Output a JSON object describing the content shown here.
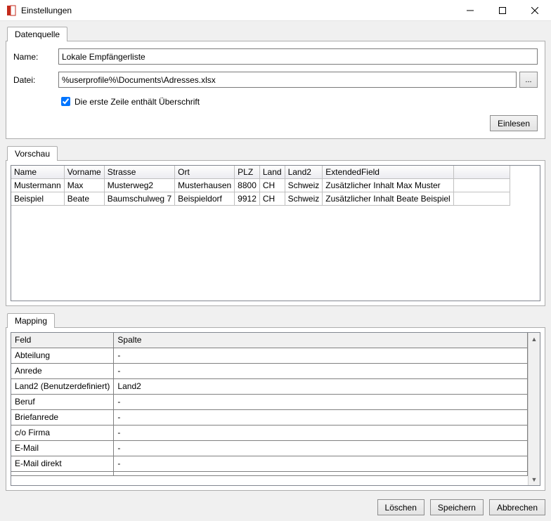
{
  "window": {
    "title": "Einstellungen"
  },
  "tabs": {
    "datenquelle": "Datenquelle",
    "vorschau": "Vorschau",
    "mapping": "Mapping"
  },
  "datenquelle": {
    "name_label": "Name:",
    "name_value": "Lokale Empfängerliste",
    "datei_label": "Datei:",
    "datei_value": "%userprofile%\\Documents\\Adresses.xlsx",
    "browse_label": "...",
    "first_row_header_label": "Die erste Zeile enthält Überschrift",
    "first_row_header_checked": true,
    "einlesen_label": "Einlesen"
  },
  "preview": {
    "columns": [
      "Name",
      "Vorname",
      "Strasse",
      "Ort",
      "PLZ",
      "Land",
      "Land2",
      "ExtendedField"
    ],
    "rows": [
      [
        "Mustermann",
        "Max",
        "Musterweg2",
        "Musterhausen",
        "8800",
        "CH",
        "Schweiz",
        "Zusätzlicher Inhalt Max Muster"
      ],
      [
        "Beispiel",
        "Beate",
        "Baumschulweg 7",
        "Beispieldorf",
        "9912",
        "CH",
        "Schweiz",
        "Zusätzlicher Inhalt Beate Beispiel"
      ]
    ]
  },
  "mapping": {
    "columns": [
      "Feld",
      "Spalte"
    ],
    "rows": [
      [
        "Abteilung",
        "-"
      ],
      [
        "Anrede",
        "-"
      ],
      [
        "Land2 (Benutzerdefiniert)",
        "Land2"
      ],
      [
        "Beruf",
        "-"
      ],
      [
        "Briefanrede",
        "-"
      ],
      [
        "c/o Firma",
        "-"
      ],
      [
        "E-Mail",
        "-"
      ],
      [
        "E-Mail direkt",
        "-"
      ]
    ]
  },
  "footer": {
    "loeschen": "Löschen",
    "speichern": "Speichern",
    "abbrechen": "Abbrechen"
  }
}
